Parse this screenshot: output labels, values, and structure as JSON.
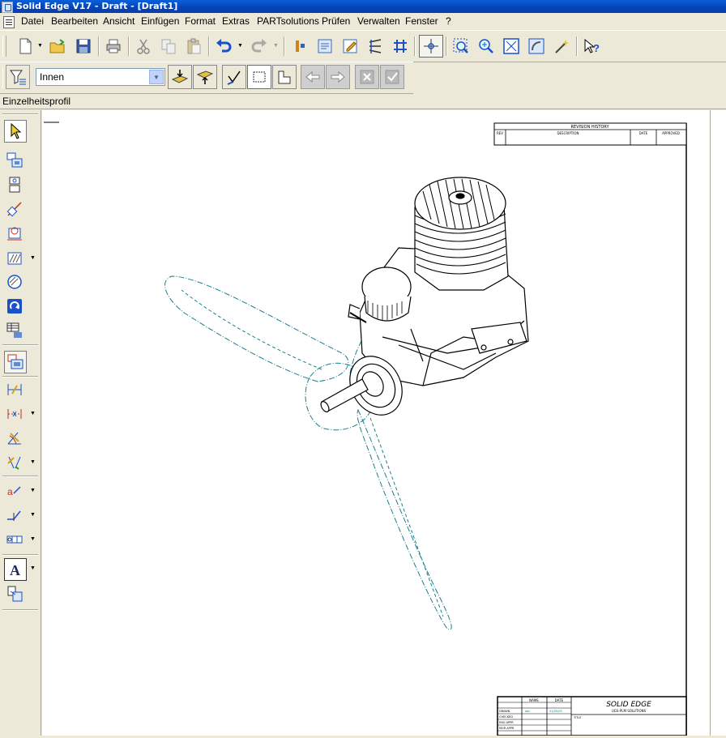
{
  "window": {
    "title": "Solid Edge V17 - Draft - [Draft1]"
  },
  "menubar": [
    {
      "label": "Datei"
    },
    {
      "label": "Bearbeiten"
    },
    {
      "label": "Ansicht"
    },
    {
      "label": "Einfügen"
    },
    {
      "label": "Format"
    },
    {
      "label": "Extras"
    },
    {
      "label": "PARTsolutions"
    },
    {
      "label": "Prüfen"
    },
    {
      "label": "Verwalten"
    },
    {
      "label": "Fenster"
    },
    {
      "label": "?"
    }
  ],
  "toolbar": {
    "icons": [
      "new-document-icon",
      "open-folder-icon",
      "save-icon",
      "print-icon",
      "cut-icon",
      "copy-icon",
      "paste-icon",
      "undo-icon",
      "redo-icon",
      "tools-icon",
      "library-icon",
      "edit-icon",
      "lines-icon",
      "grid-icon",
      "crosshair-icon",
      "zoom-area-icon",
      "zoom-icon",
      "fit-icon",
      "pan-icon",
      "magic-wand-icon",
      "help-pointer-icon"
    ]
  },
  "selectbar": {
    "filter_value": "Innen"
  },
  "status": {
    "prompt": "Einzelheitsprofil"
  },
  "drawing": {
    "revision_block": {
      "header": "REVISION HISTORY",
      "col_rev": "REV",
      "col_description": "DESCRIPTION",
      "col_date": "DATE",
      "col_approved": "APPROVED"
    },
    "title_block": {
      "col_name": "NAME",
      "col_date": "DATE",
      "rows": [
        "DRAWN",
        "CHECKED",
        "ENG APPR",
        "MGR APPR"
      ],
      "drawn_name": "abc",
      "drawn_date": "01/05/05",
      "company": "SOLID EDGE",
      "company_sub": "UGS-PLM SOLUTIONS",
      "title_label": "TITLE"
    }
  }
}
